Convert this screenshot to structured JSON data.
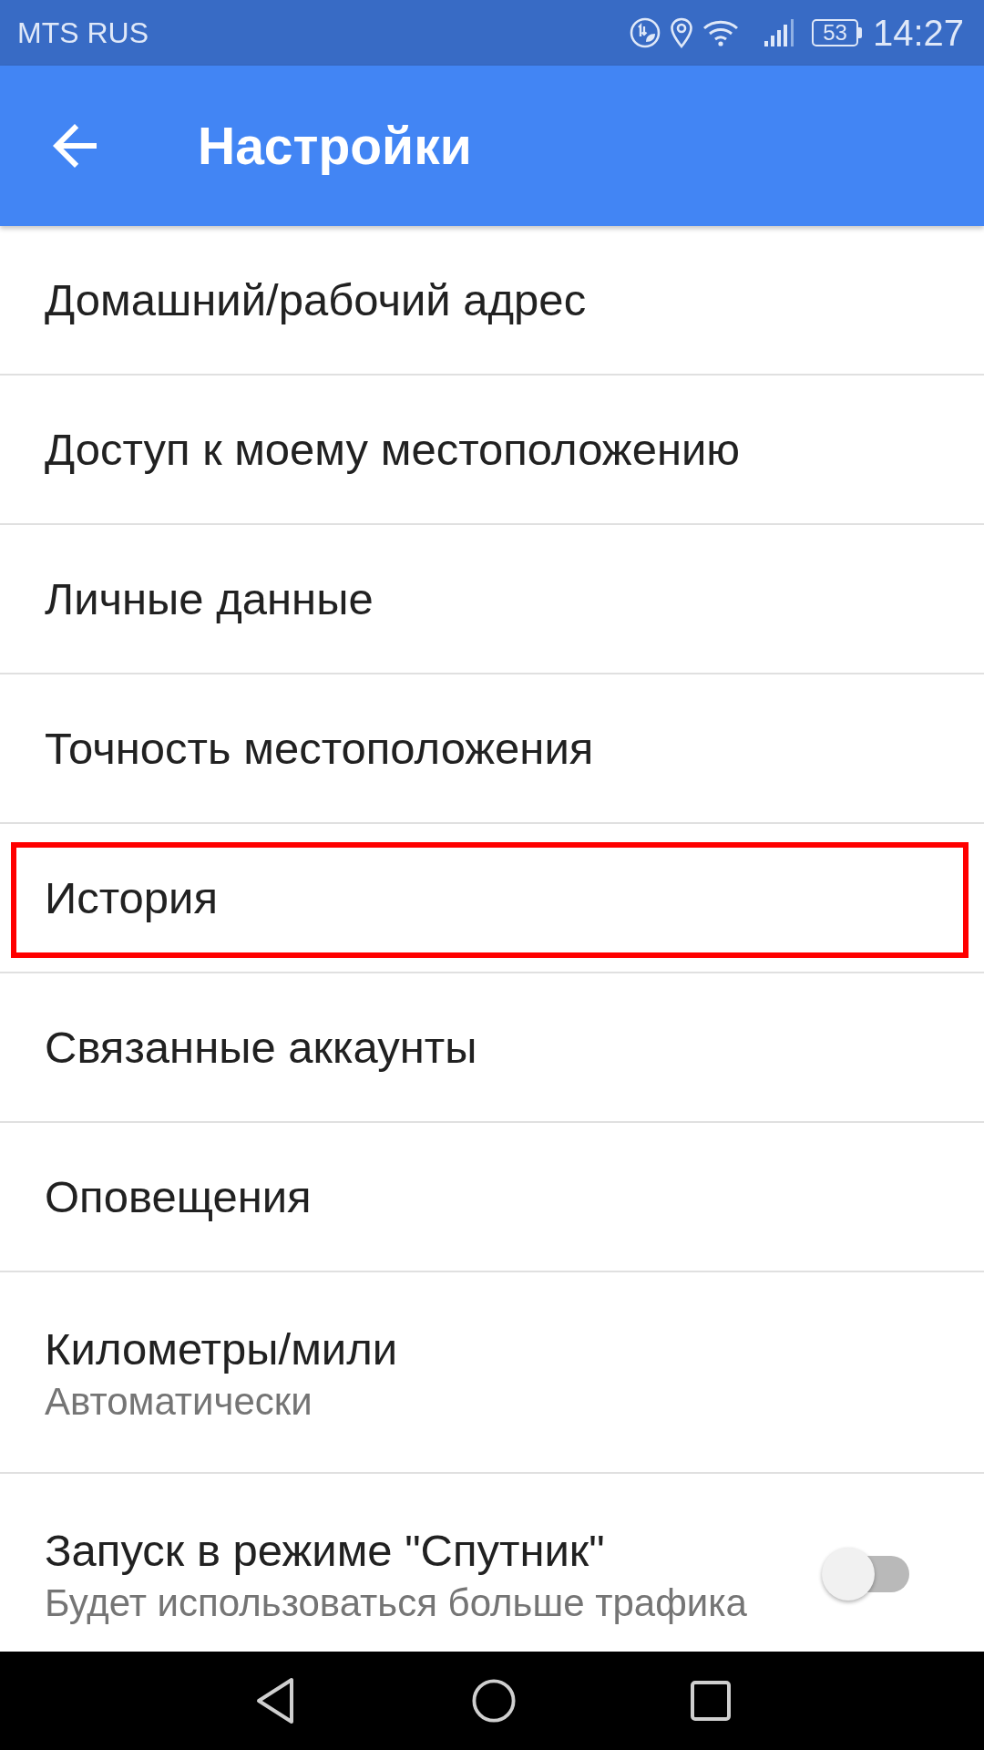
{
  "status_bar": {
    "carrier": "MTS RUS",
    "battery": "53",
    "time": "14:27"
  },
  "app_bar": {
    "title": "Настройки"
  },
  "items": [
    {
      "kind": "link",
      "title": "Домашний/рабочий адрес",
      "highlighted": false
    },
    {
      "kind": "link",
      "title": "Доступ к моему местоположению",
      "highlighted": false
    },
    {
      "kind": "link",
      "title": "Личные данные",
      "highlighted": false
    },
    {
      "kind": "link",
      "title": "Точность местоположения",
      "highlighted": false
    },
    {
      "kind": "link",
      "title": "История",
      "highlighted": true
    },
    {
      "kind": "link",
      "title": "Связанные аккаунты",
      "highlighted": false
    },
    {
      "kind": "link",
      "title": "Оповещения",
      "highlighted": false
    },
    {
      "kind": "link",
      "title": "Километры/мили",
      "subtitle": "Автоматически",
      "highlighted": false
    },
    {
      "kind": "toggle",
      "title": "Запуск в режиме \"Спутник\"",
      "subtitle": "Будет использоваться больше трафика",
      "on": false,
      "highlighted": false
    }
  ]
}
